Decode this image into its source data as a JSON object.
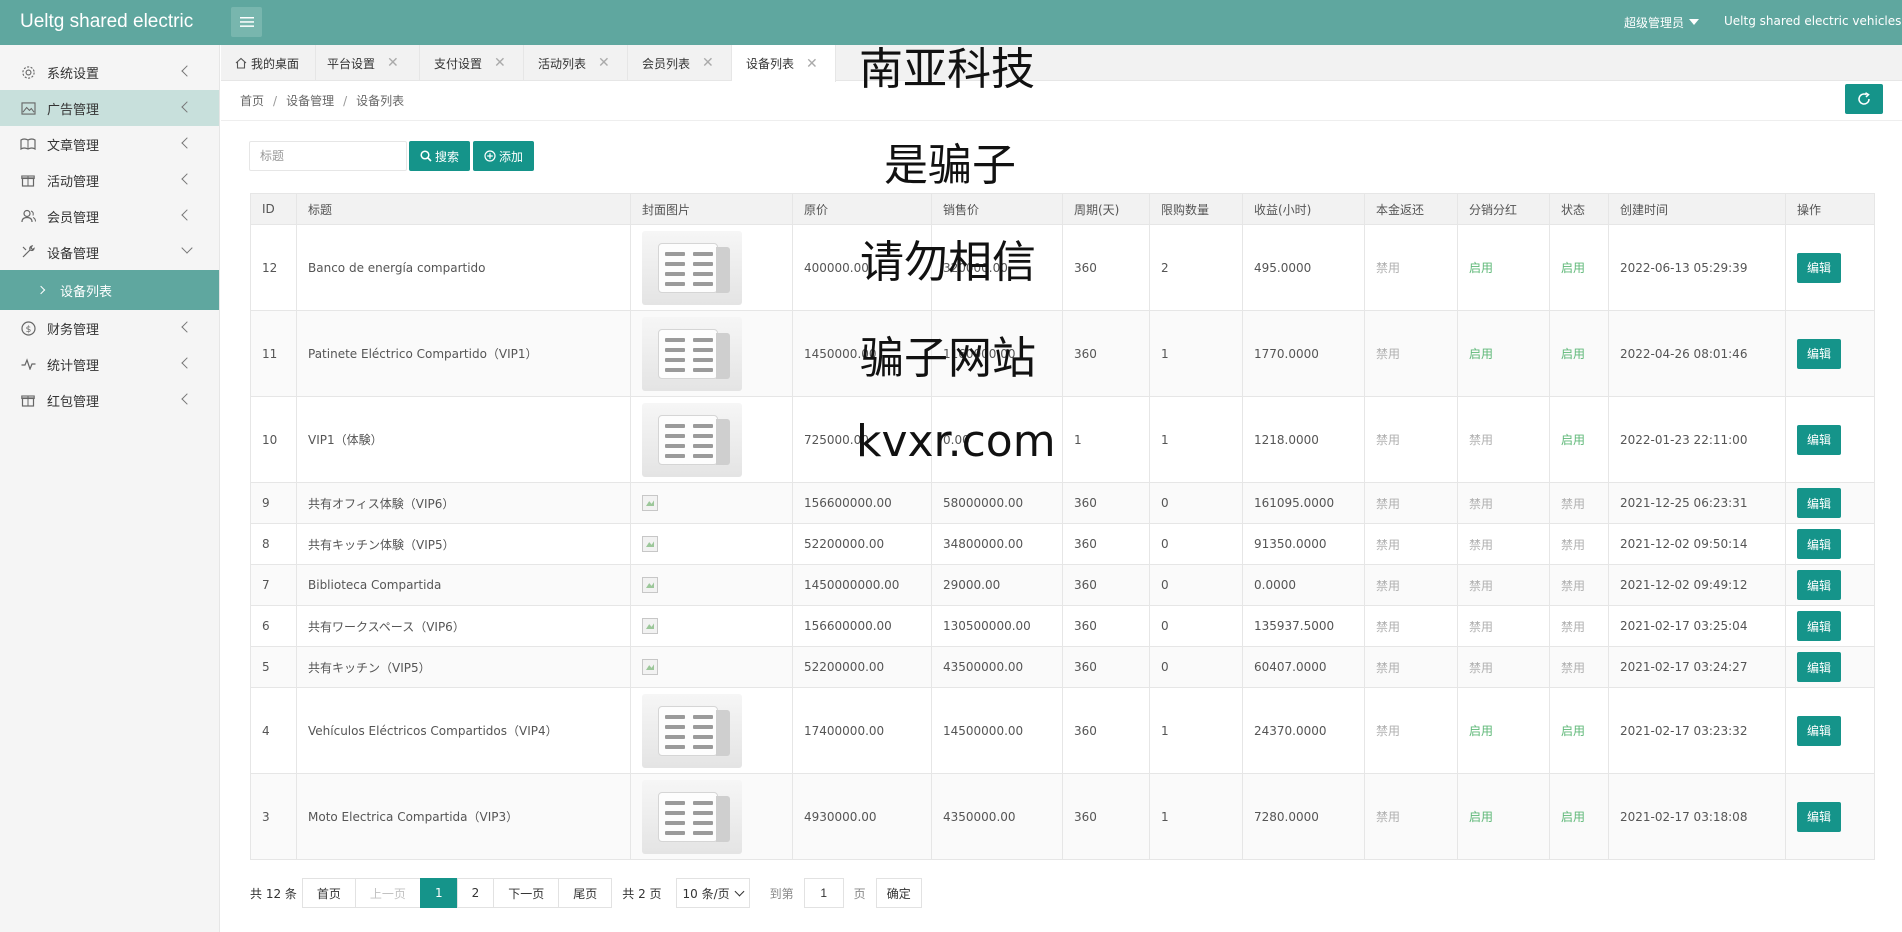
{
  "header": {
    "logo": "Ueltg shared electric",
    "admin_label": "超级管理员",
    "site_name": "Ueltg shared electric vehicles"
  },
  "sidebar": {
    "items": [
      {
        "label": "系统设置",
        "icon": "gear-icon"
      },
      {
        "label": "广告管理",
        "icon": "image-icon"
      },
      {
        "label": "文章管理",
        "icon": "book-icon"
      },
      {
        "label": "活动管理",
        "icon": "gift-icon"
      },
      {
        "label": "会员管理",
        "icon": "users-icon"
      },
      {
        "label": "设备管理",
        "icon": "tools-icon"
      },
      {
        "label": "财务管理",
        "icon": "dollar-icon"
      },
      {
        "label": "统计管理",
        "icon": "pulse-icon"
      },
      {
        "label": "红包管理",
        "icon": "redpacket-icon"
      }
    ],
    "sub_item": "设备列表"
  },
  "tabs": [
    "我的桌面",
    "平台设置",
    "支付设置",
    "活动列表",
    "会员列表",
    "设备列表"
  ],
  "breadcrumb": [
    "首页",
    "设备管理",
    "设备列表"
  ],
  "search": {
    "placeholder": "标题",
    "search_label": "搜索",
    "add_label": "添加"
  },
  "table": {
    "headers": [
      "ID",
      "标题",
      "封面图片",
      "原价",
      "销售价",
      "周期(天)",
      "限购数量",
      "收益(小时)",
      "本金返还",
      "分销分红",
      "状态",
      "创建时间",
      "操作"
    ],
    "edit_label": "编辑",
    "rows": [
      {
        "id": "12",
        "title": "Banco de energía compartido",
        "img": true,
        "price": "400000.00",
        "sale": "320000.00",
        "cycle": "360",
        "limit": "2",
        "income": "495.0000",
        "principal": "禁用",
        "dist": "启用",
        "status": "启用",
        "created": "2022-06-13 05:29:39"
      },
      {
        "id": "11",
        "title": "Patinete Eléctrico Compartido（VIP1）",
        "img": true,
        "price": "1450000.00",
        "sale": "1160000.00",
        "cycle": "360",
        "limit": "1",
        "income": "1770.0000",
        "principal": "禁用",
        "dist": "启用",
        "status": "启用",
        "created": "2022-04-26 08:01:46"
      },
      {
        "id": "10",
        "title": "VIP1（体験）",
        "img": true,
        "price": "725000.00",
        "sale": "0.00",
        "cycle": "1",
        "limit": "1",
        "income": "1218.0000",
        "principal": "禁用",
        "dist": "禁用",
        "status": "启用",
        "created": "2022-01-23 22:11:00"
      },
      {
        "id": "9",
        "title": "共有オフィス体験（VIP6）",
        "img": false,
        "price": "156600000.00",
        "sale": "58000000.00",
        "cycle": "360",
        "limit": "0",
        "income": "161095.0000",
        "principal": "禁用",
        "dist": "禁用",
        "status": "禁用",
        "created": "2021-12-25 06:23:31"
      },
      {
        "id": "8",
        "title": "共有キッチン体験（VIP5）",
        "img": false,
        "price": "52200000.00",
        "sale": "34800000.00",
        "cycle": "360",
        "limit": "0",
        "income": "91350.0000",
        "principal": "禁用",
        "dist": "禁用",
        "status": "禁用",
        "created": "2021-12-02 09:50:14"
      },
      {
        "id": "7",
        "title": "Biblioteca Compartida",
        "img": false,
        "price": "1450000000.00",
        "sale": "29000.00",
        "cycle": "360",
        "limit": "0",
        "income": "0.0000",
        "principal": "禁用",
        "dist": "禁用",
        "status": "禁用",
        "created": "2021-12-02 09:49:12"
      },
      {
        "id": "6",
        "title": "共有ワークスペース（VIP6）",
        "img": false,
        "price": "156600000.00",
        "sale": "130500000.00",
        "cycle": "360",
        "limit": "0",
        "income": "135937.5000",
        "principal": "禁用",
        "dist": "禁用",
        "status": "禁用",
        "created": "2021-02-17 03:25:04"
      },
      {
        "id": "5",
        "title": "共有キッチン（VIP5）",
        "img": false,
        "price": "52200000.00",
        "sale": "43500000.00",
        "cycle": "360",
        "limit": "0",
        "income": "60407.0000",
        "principal": "禁用",
        "dist": "禁用",
        "status": "禁用",
        "created": "2021-02-17 03:24:27"
      },
      {
        "id": "4",
        "title": "Vehículos Eléctricos Compartidos（VIP4）",
        "img": true,
        "price": "17400000.00",
        "sale": "14500000.00",
        "cycle": "360",
        "limit": "1",
        "income": "24370.0000",
        "principal": "禁用",
        "dist": "启用",
        "status": "启用",
        "created": "2021-02-17 03:23:32"
      },
      {
        "id": "3",
        "title": "Moto Electrica Compartida（VIP3）",
        "img": true,
        "price": "4930000.00",
        "sale": "4350000.00",
        "cycle": "360",
        "limit": "1",
        "income": "7280.0000",
        "principal": "禁用",
        "dist": "启用",
        "status": "启用",
        "created": "2021-02-17 03:18:08"
      }
    ]
  },
  "pagination": {
    "total": "共 12 条",
    "first": "首页",
    "prev": "上一页",
    "pages": [
      "1",
      "2"
    ],
    "next": "下一页",
    "last": "尾页",
    "page_count": "共 2 页",
    "per_page": "10 条/页",
    "goto_prefix": "到第",
    "goto_value": "1",
    "goto_suffix": "页",
    "confirm": "确定"
  },
  "watermark": [
    "南亚科技",
    "是骗子",
    "请勿相信",
    "骗子网站",
    "kvxr.com"
  ],
  "colors": {
    "brand": "#5fa79f",
    "button": "#15948a",
    "enabled": "#5fb878",
    "disabled": "#b0b0b0"
  }
}
